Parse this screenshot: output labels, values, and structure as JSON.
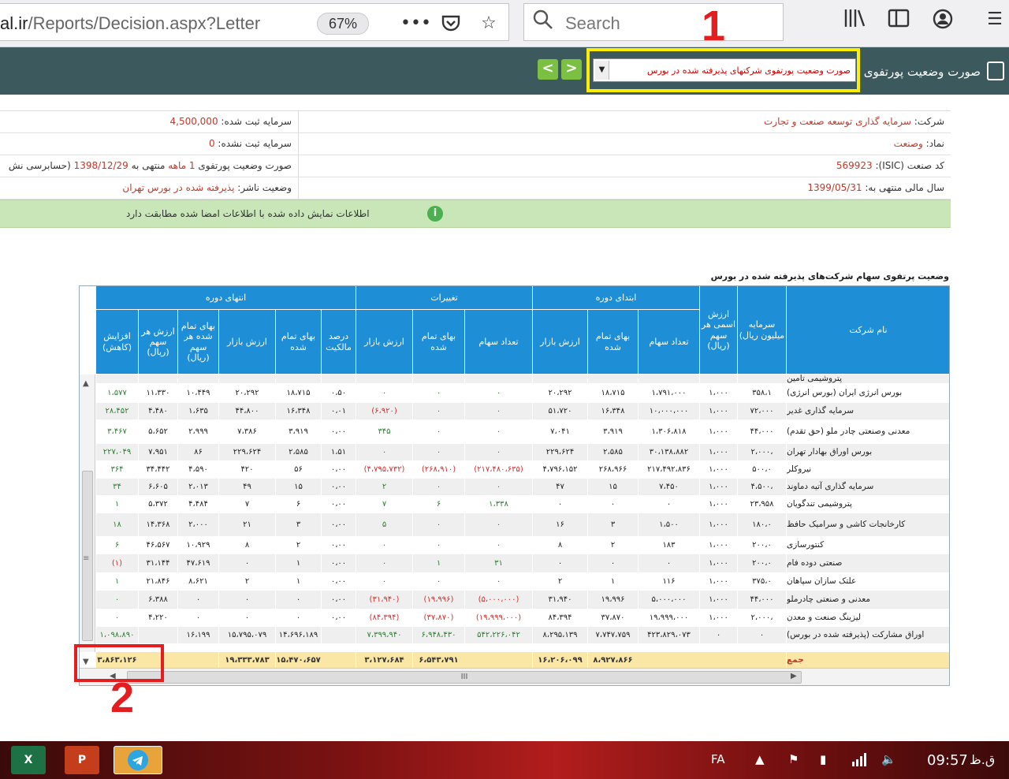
{
  "browser": {
    "url_prefix": "al.ir",
    "url_path": "/Reports/Decision.aspx?Letter",
    "zoom": "67%",
    "search_placeholder": "Search"
  },
  "header": {
    "title": "صورت وضعیت پورتفوی",
    "report_select_value": "صورت وضعیت پورتفوی شرکتهای پذیرفته شده در بورس",
    "prev_label": "<",
    "next_label": ">"
  },
  "annotations": {
    "label_1": "1",
    "label_2": "2"
  },
  "info": {
    "company_label": "شرکت:",
    "company_value": "سرمایه گذاری توسعه صنعت و تجارت",
    "symbol_label": "نماد:",
    "symbol_value": "وصنعت",
    "isic_label": "کد صنعت (ISIC):",
    "isic_value": "569923",
    "fiscal_label": "سال مالی منتهی به:",
    "fiscal_value": "1399/05/31",
    "reg_capital_label": "سرمایه ثبت شده:",
    "reg_capital_value": "4,500,000",
    "unreg_capital_label": "سرمایه ثبت نشده:",
    "unreg_capital_value": "0",
    "status_prefix": "صورت وضعیت پورتفوی",
    "status_months": "1 ماهه",
    "status_middle": "منتهی به",
    "status_date": "1398/12/29",
    "status_suffix": "(حسابرسی نش",
    "publisher_label": "وضعیت ناشر:",
    "publisher_value": "پذیرفته شده در بورس تهران"
  },
  "notice": "اطلاعات نمایش داده شده با اطلاعات امضا شده مطابقت دارد",
  "grid_title": "وضعیت پرتفوی سهام شرکت‌های پذیرفته شده در بورس",
  "grid": {
    "groups": {
      "start": "ابتدای دوره",
      "changes": "تغییرات",
      "end": "انتهای دوره"
    },
    "columns": {
      "name": "نام شرکت",
      "capital": "سرمایه میلیون ریال)",
      "nominal": "ارزش اسمی هر سهم (ریال)",
      "s_count": "تعداد سهام",
      "s_cost": "بهای تمام شده",
      "s_market": "ارزش بازار",
      "c_count": "تعداد سهام",
      "c_cost": "بهای تمام شده",
      "c_market": "ارزش بازار",
      "e_pct": "درصد مالکیت",
      "e_cost": "بهای تمام شده",
      "e_market": "ارزش بازار",
      "e_unit_cost": "بهای تمام شده هر سهم (ریال)",
      "e_unit_value": "ارزش هر سهم (ریال)",
      "e_change": "افزایش (کاهش)"
    },
    "rows": [
      {
        "name": "پتروشیمی تامین",
        "capital": "",
        "nominal": "",
        "s_count": "",
        "s_cost": "",
        "s_market": "",
        "c_count": "",
        "c_cost": "",
        "c_market": "",
        "e_pct": "",
        "e_cost": "",
        "e_market": "",
        "e_unit_cost": "",
        "e_unit_value": "",
        "e_change": ""
      },
      {
        "name": "بورس انرژی ایران (بورس انرژی)",
        "capital": "۳۵۸،۱",
        "nominal": "۱،۰۰۰",
        "s_count": "۱،۷۹۱،۰۰۰",
        "s_cost": "۱۸،۷۱۵",
        "s_market": "۲۰،۲۹۲",
        "c_count": "۰",
        "c_cost": "۰",
        "c_market": "۰",
        "e_pct": "۰،۵۰",
        "e_cost": "۱۸،۷۱۵",
        "e_market": "۲۰،۲۹۲",
        "e_unit_cost": "۱۰،۴۴۹",
        "e_unit_value": "۱۱،۳۳۰",
        "e_change": "۱،۵۷۷"
      },
      {
        "name": "سرمایه گذاری غدیر",
        "capital": "۷۲،۰۰۰",
        "nominal": "۱،۰۰۰",
        "s_count": "۱۰،۰۰۰،۰۰۰",
        "s_cost": "۱۶،۳۴۸",
        "s_market": "۵۱،۷۲۰",
        "c_count": "۰",
        "c_cost": "۰",
        "c_market": "(۶،۹۲۰)",
        "e_pct": "۰،۰۱",
        "e_cost": "۱۶،۳۴۸",
        "e_market": "۴۴،۸۰۰",
        "e_unit_cost": "۱،۶۳۵",
        "e_unit_value": "۴،۴۸۰",
        "e_change": "۲۸،۴۵۲"
      },
      {
        "name": "معدنی وصنعتی چادر ملو (حق تقدم)",
        "capital": "۴۴،۰۰۰",
        "nominal": "۱،۰۰۰",
        "s_count": "۱،۳۰۶،۸۱۸",
        "s_cost": "۳،۹۱۹",
        "s_market": "۷،۰۴۱",
        "c_count": "۰",
        "c_cost": "۰",
        "c_market": "۳۴۵",
        "e_pct": "۰،۰۰",
        "e_cost": "۳،۹۱۹",
        "e_market": "۷،۳۸۶",
        "e_unit_cost": "۲،۹۹۹",
        "e_unit_value": "۵،۶۵۲",
        "e_change": "۳،۴۶۷"
      },
      {
        "name": "بورس اوراق بهادار تهران",
        "capital": "۲،۰۰۰،",
        "nominal": "۱،۰۰۰",
        "s_count": "۳۰،۱۳۸،۸۸۲",
        "s_cost": "۲،۵۸۵",
        "s_market": "۲۲۹،۶۲۴",
        "c_count": "۰",
        "c_cost": "۰",
        "c_market": "۰",
        "e_pct": "۱،۵۱",
        "e_cost": "۲،۵۸۵",
        "e_market": "۲۲۹،۶۲۴",
        "e_unit_cost": "۸۶",
        "e_unit_value": "۷،۹۵۱",
        "e_change": "۲۲۷،۰۴۹"
      },
      {
        "name": "نیروکلر",
        "capital": "۵۰۰،۰",
        "nominal": "۱،۰۰۰",
        "s_count": "۲۱۷،۴۹۲،۸۳۶",
        "s_cost": "۲۶۸،۹۶۶",
        "s_market": "۴،۷۹۶،۱۵۲",
        "c_count": "(۲۱۷،۴۸۰،۶۳۵)",
        "c_cost": "(۲۶۸،۹۱۰)",
        "c_market": "(۴،۷۹۵،۷۳۲)",
        "e_pct": "۰،۰۰",
        "e_cost": "۵۶",
        "e_market": "۴۲۰",
        "e_unit_cost": "۴،۵۹۰",
        "e_unit_value": "۳۴،۴۴۲",
        "e_change": "۳۶۴"
      },
      {
        "name": "سرمایه گذاری آتیه دماوند",
        "capital": "۴،۵۰۰،",
        "nominal": "۱،۰۰۰",
        "s_count": "۷،۴۵۰",
        "s_cost": "۱۵",
        "s_market": "۴۷",
        "c_count": "۰",
        "c_cost": "۰",
        "c_market": "۲",
        "e_pct": "۰،۰۰",
        "e_cost": "۱۵",
        "e_market": "۴۹",
        "e_unit_cost": "۲،۰۱۳",
        "e_unit_value": "۶،۶۰۵",
        "e_change": "۳۴"
      },
      {
        "name": "پتروشیمی تندگویان",
        "capital": "۲۳،۹۵۸",
        "nominal": "۱،۰۰۰",
        "s_count": "۰",
        "s_cost": "۰",
        "s_market": "۰",
        "c_count": "۱،۳۳۸",
        "c_cost": "۶",
        "c_market": "۷",
        "e_pct": "۰،۰۰",
        "e_cost": "۶",
        "e_market": "۷",
        "e_unit_cost": "۴،۴۸۴",
        "e_unit_value": "۵،۳۷۲",
        "e_change": "۱"
      },
      {
        "name": "کارخانجات کاشی و سرامیک حافظ",
        "capital": "۱۸۰،۰",
        "nominal": "۱،۰۰۰",
        "s_count": "۱،۵۰۰",
        "s_cost": "۳",
        "s_market": "۱۶",
        "c_count": "۰",
        "c_cost": "۰",
        "c_market": "۵",
        "e_pct": "۰،۰۰",
        "e_cost": "۳",
        "e_market": "۲۱",
        "e_unit_cost": "۲،۰۰۰",
        "e_unit_value": "۱۴،۳۶۸",
        "e_change": "۱۸"
      },
      {
        "name": "کنتورسازی",
        "capital": "۲۰۰،۰",
        "nominal": "۱،۰۰۰",
        "s_count": "۱۸۳",
        "s_cost": "۲",
        "s_market": "۸",
        "c_count": "۰",
        "c_cost": "۰",
        "c_market": "۰",
        "e_pct": "۰،۰۰",
        "e_cost": "۲",
        "e_market": "۸",
        "e_unit_cost": "۱۰،۹۲۹",
        "e_unit_value": "۴۶،۵۶۷",
        "e_change": "۶"
      },
      {
        "name": "صنعتی دوده فام",
        "capital": "۲۰۰،۰",
        "nominal": "۱،۰۰۰",
        "s_count": "۰",
        "s_cost": "۰",
        "s_market": "۰",
        "c_count": "۳۱",
        "c_cost": "۱",
        "c_market": "۰",
        "e_pct": "۰،۰۰",
        "e_cost": "۱",
        "e_market": "۰",
        "e_unit_cost": "۴۷،۶۱۹",
        "e_unit_value": "۳۱،۱۴۴",
        "e_change": "(۱)"
      },
      {
        "name": "علتک سازان سپاهان",
        "capital": "۳۷۵،۰",
        "nominal": "۱،۰۰۰",
        "s_count": "۱۱۶",
        "s_cost": "۱",
        "s_market": "۲",
        "c_count": "۰",
        "c_cost": "۰",
        "c_market": "۰",
        "e_pct": "۰،۰۰",
        "e_cost": "۱",
        "e_market": "۲",
        "e_unit_cost": "۸،۶۲۱",
        "e_unit_value": "۲۱،۸۴۶",
        "e_change": "۱"
      },
      {
        "name": "معدنی و صنعتی چادرملو",
        "capital": "۴۴،۰۰۰",
        "nominal": "۱،۰۰۰",
        "s_count": "۵،۰۰۰،۰۰۰",
        "s_cost": "۱۹،۹۹۶",
        "s_market": "۳۱،۹۴۰",
        "c_count": "(۵،۰۰۰،۰۰۰)",
        "c_cost": "(۱۹،۹۹۶)",
        "c_market": "(۳۱،۹۴۰)",
        "e_pct": "۰،۰۰",
        "e_cost": "۰",
        "e_market": "۰",
        "e_unit_cost": "۰",
        "e_unit_value": "۶،۳۸۸",
        "e_change": "۰"
      },
      {
        "name": "لیزینگ صنعت و معدن",
        "capital": "۲،۰۰۰،",
        "nominal": "۱،۰۰۰",
        "s_count": "۱۹،۹۹۹،۰۰۰",
        "s_cost": "۳۷،۸۷۰",
        "s_market": "۸۴،۳۹۴",
        "c_count": "(۱۹،۹۹۹،۰۰۰)",
        "c_cost": "(۳۷،۸۷۰)",
        "c_market": "(۸۴،۳۹۴)",
        "e_pct": "۰،۰۰",
        "e_cost": "۰",
        "e_market": "۰",
        "e_unit_cost": "۰",
        "e_unit_value": "۴،۲۲۰",
        "e_change": "۰"
      },
      {
        "name": "اوراق مشارکت (پذیرفته شده در بورس)",
        "capital": "۰",
        "nominal": "۰",
        "s_count": "۴۲۳،۸۲۹،۰۷۳",
        "s_cost": "۷،۷۴۷،۷۵۹",
        "s_market": "۸،۲۹۵،۱۳۹",
        "c_count": "۵۴۲،۲۲۶،۰۴۲",
        "c_cost": "۶،۹۴۸،۴۳۰",
        "c_market": "۷،۳۹۹،۹۴۰",
        "e_pct": "",
        "e_cost": "۱۴،۶۹۶،۱۸۹",
        "e_market": "۱۵،۷۹۵،۰۷۹",
        "e_unit_cost": "۱۶،۱۹۹",
        "e_unit_value": "",
        "e_change": "۱،۰۹۸،۸۹۰"
      }
    ],
    "total": {
      "label": "جمع",
      "s_cost": "۸،۹۲۷،۸۶۶",
      "s_market": "۱۶،۲۰۶،۰۹۹",
      "c_cost": "۶،۵۴۳،۷۹۱",
      "c_market": "۳،۱۲۷،۶۸۴",
      "e_cost": "۱۵،۴۷۰،۶۵۷",
      "e_market": "۱۹،۳۳۳،۷۸۳",
      "e_change": "۳،۸۶۳،۱۲۶"
    },
    "hscroll_label": "III"
  },
  "taskbar": {
    "lang": "FA",
    "time": "09:57",
    "ampm": "ق.ظ"
  }
}
